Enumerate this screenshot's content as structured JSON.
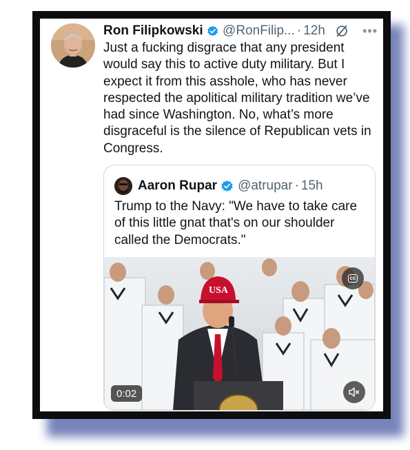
{
  "tweet": {
    "author_name": "Ron Filipkowski",
    "handle": "@RonFilip...",
    "time_sep": "·",
    "time": "12h",
    "more_label": "•••",
    "text": "Just a fucking disgrace that any president would say this to active duty military. But I expect it from this asshole, who has never respected the apolitical military tradition we’ve had since Washington. No, what’s more disgraceful is the silence of Republican vets in Congress."
  },
  "quoted": {
    "author_name": "Aaron Rupar",
    "handle": "@atrupar",
    "time_sep": "·",
    "time": "15h",
    "text": "Trump to the Navy: \"We have to take care of this little gnat that's on our shoulder called the Democrats.\"",
    "media": {
      "cap_text": "USA",
      "cc_label": "cc",
      "duration": "0:02",
      "mute_icon": "speaker-muted-icon"
    }
  },
  "icons": {
    "verified": "verified-badge-icon",
    "grok": "grok-icon",
    "more": "more-options-icon"
  },
  "colors": {
    "verified_blue": "#1d9bf0",
    "text": "#0f1419",
    "secondary": "#536471",
    "frame": "#0d0d0d",
    "shadow": "#5f6fae"
  }
}
